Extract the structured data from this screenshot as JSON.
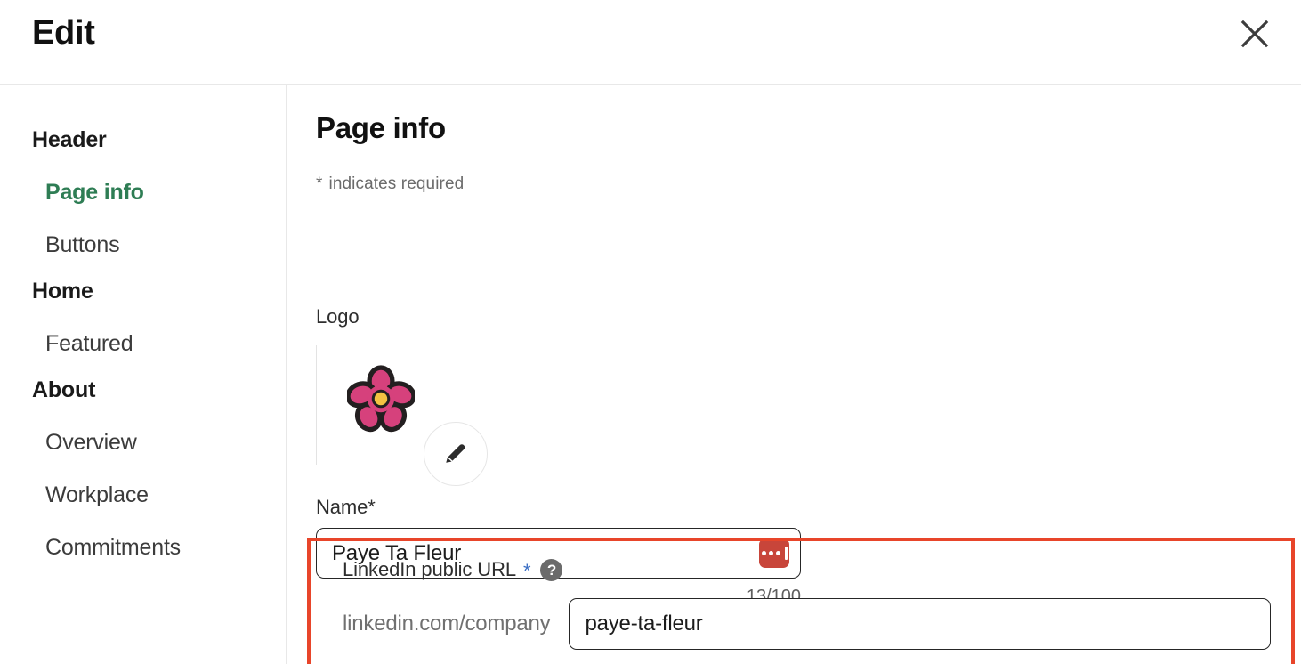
{
  "modal": {
    "title": "Edit",
    "close_icon": "close-icon"
  },
  "sidebar": {
    "items": [
      {
        "label": "Header",
        "type": "group",
        "active": false
      },
      {
        "label": "Page info",
        "type": "item",
        "active": true
      },
      {
        "label": "Buttons",
        "type": "item",
        "active": false
      },
      {
        "label": "Home",
        "type": "group",
        "active": false
      },
      {
        "label": "Featured",
        "type": "item",
        "active": false
      },
      {
        "label": "About",
        "type": "group",
        "active": false
      },
      {
        "label": "Overview",
        "type": "item",
        "active": false
      },
      {
        "label": "Workplace",
        "type": "item",
        "active": false
      },
      {
        "label": "Commitments",
        "type": "item",
        "active": false
      }
    ]
  },
  "main": {
    "section_title": "Page info",
    "required_note_asterisk": "*",
    "required_note_text": "indicates required",
    "logo": {
      "label": "Logo",
      "image_description": "pink-flower-logo",
      "edit_button_icon": "pencil-icon",
      "petal_color": "#d6417c",
      "center_color": "#f3c242",
      "outline_color": "#231f20"
    },
    "name_field": {
      "label": "Name*",
      "value": "Paye Ta Fleur",
      "placeholder": "",
      "char_count": "13/100",
      "password_manager_icon": "lastpass-icon",
      "password_manager_color": "#c8453a"
    },
    "linkedin_url_field": {
      "label": "LinkedIn public URL",
      "required_marker": "*",
      "help_icon": "question-mark-icon",
      "help_icon_color": "#6b6b6b",
      "prefix": "linkedin.com/company",
      "value": "paye-ta-fleur",
      "placeholder": "",
      "highlight_color": "#e8452a"
    }
  },
  "colors": {
    "accent_green": "#2e7d54",
    "highlight_red": "#e8452a",
    "blue_asterisk": "#3a6ec4",
    "border_gray": "#e8e8e8"
  }
}
